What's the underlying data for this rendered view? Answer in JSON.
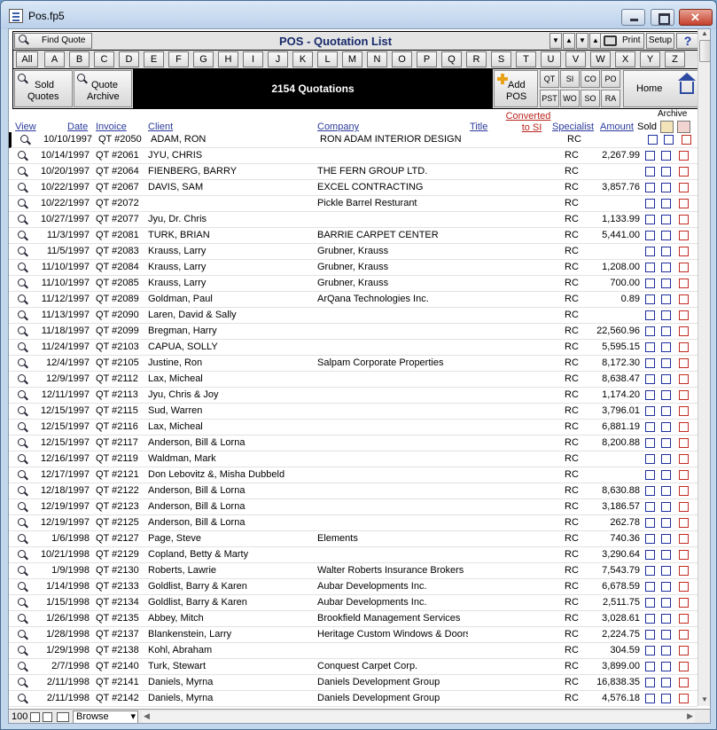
{
  "window": {
    "title": "Pos.fp5"
  },
  "toolbar": {
    "find_label": "Find Quote",
    "page_title": "POS - Quotation List",
    "print_label": "Print",
    "setup_label": "Setup",
    "help_label": "?"
  },
  "alphabet": [
    "All",
    "A",
    "B",
    "C",
    "D",
    "E",
    "F",
    "G",
    "H",
    "I",
    "J",
    "K",
    "L",
    "M",
    "N",
    "O",
    "P",
    "Q",
    "R",
    "S",
    "T",
    "U",
    "V",
    "W",
    "X",
    "Y",
    "Z"
  ],
  "buttons": {
    "sold_quotes": [
      "Sold",
      "Quotes"
    ],
    "quote_archive": [
      "Quote",
      "Archive"
    ],
    "count_text": "2154 Quotations",
    "add_pos": [
      "Add",
      "POS"
    ],
    "small": [
      "QT",
      "SI",
      "CO",
      "PO",
      "PST",
      "WO",
      "SO",
      "RA"
    ],
    "home": "Home"
  },
  "columns": {
    "view": "View",
    "date": "Date",
    "invoice": "Invoice",
    "client": "Client",
    "company": "Company",
    "title": "Title",
    "converted": [
      "Converted",
      "to SI"
    ],
    "specialist": "Specialist",
    "amount": "Amount",
    "sold": "Sold",
    "archive": "Archive"
  },
  "rows": [
    {
      "date": "10/10/1997",
      "invoice": "QT #2050",
      "client": "ADAM, RON",
      "company": "RON ADAM INTERIOR DESIGN",
      "specialist": "RC",
      "amount": ""
    },
    {
      "date": "10/14/1997",
      "invoice": "QT #2061",
      "client": "JYU, CHRIS",
      "company": "",
      "specialist": "RC",
      "amount": "2,267.99"
    },
    {
      "date": "10/20/1997",
      "invoice": "QT #2064",
      "client": "FIENBERG, BARRY",
      "company": "THE FERN GROUP LTD.",
      "specialist": "RC",
      "amount": ""
    },
    {
      "date": "10/22/1997",
      "invoice": "QT #2067",
      "client": "DAVIS, SAM",
      "company": "EXCEL CONTRACTING",
      "specialist": "RC",
      "amount": "3,857.76"
    },
    {
      "date": "10/22/1997",
      "invoice": "QT #2072",
      "client": "",
      "company": "Pickle Barrel   Resturant",
      "specialist": "RC",
      "amount": ""
    },
    {
      "date": "10/27/1997",
      "invoice": "QT #2077",
      "client": "Jyu, Dr. Chris",
      "company": "",
      "specialist": "RC",
      "amount": "1,133.99"
    },
    {
      "date": "11/3/1997",
      "invoice": "QT #2081",
      "client": "TURK, BRIAN",
      "company": "BARRIE CARPET CENTER",
      "specialist": "RC",
      "amount": "5,441.00"
    },
    {
      "date": "11/5/1997",
      "invoice": "QT #2083",
      "client": "Krauss, Larry",
      "company": "Grubner, Krauss",
      "specialist": "RC",
      "amount": ""
    },
    {
      "date": "11/10/1997",
      "invoice": "QT #2084",
      "client": "Krauss, Larry",
      "company": "Grubner, Krauss",
      "specialist": "RC",
      "amount": "1,208.00"
    },
    {
      "date": "11/10/1997",
      "invoice": "QT #2085",
      "client": "Krauss, Larry",
      "company": "Grubner, Krauss",
      "specialist": "RC",
      "amount": "700.00"
    },
    {
      "date": "11/12/1997",
      "invoice": "QT #2089",
      "client": "Goldman, Paul",
      "company": "ArQana Technologies Inc.",
      "specialist": "RC",
      "amount": "0.89"
    },
    {
      "date": "11/13/1997",
      "invoice": "QT #2090",
      "client": "Laren, David & Sally",
      "company": "",
      "specialist": "RC",
      "amount": ""
    },
    {
      "date": "11/18/1997",
      "invoice": "QT #2099",
      "client": "Bregman, Harry",
      "company": "",
      "specialist": "RC",
      "amount": "22,560.96"
    },
    {
      "date": "11/24/1997",
      "invoice": "QT #2103",
      "client": "CAPUA, SOLLY",
      "company": "",
      "specialist": "RC",
      "amount": "5,595.15"
    },
    {
      "date": "12/4/1997",
      "invoice": "QT #2105",
      "client": "Justine, Ron",
      "company": "Salpam Corporate Properties",
      "specialist": "RC",
      "amount": "8,172.30"
    },
    {
      "date": "12/9/1997",
      "invoice": "QT #2112",
      "client": "Lax, Micheal",
      "company": "",
      "specialist": "RC",
      "amount": "8,638.47"
    },
    {
      "date": "12/11/1997",
      "invoice": "QT #2113",
      "client": "Jyu, Chris & Joy",
      "company": "",
      "specialist": "RC",
      "amount": "1,174.20"
    },
    {
      "date": "12/15/1997",
      "invoice": "QT #2115",
      "client": "Sud, Warren",
      "company": "",
      "specialist": "RC",
      "amount": "3,796.01"
    },
    {
      "date": "12/15/1997",
      "invoice": "QT #2116",
      "client": "Lax, Micheal",
      "company": "",
      "specialist": "RC",
      "amount": "6,881.19"
    },
    {
      "date": "12/15/1997",
      "invoice": "QT #2117",
      "client": "Anderson, Bill & Lorna",
      "company": "",
      "specialist": "RC",
      "amount": "8,200.88"
    },
    {
      "date": "12/16/1997",
      "invoice": "QT #2119",
      "client": "Waldman, Mark",
      "company": "",
      "specialist": "RC",
      "amount": ""
    },
    {
      "date": "12/17/1997",
      "invoice": "QT #2121",
      "client": "Don Lebovitz &, Misha Dubbeld",
      "company": "",
      "specialist": "RC",
      "amount": ""
    },
    {
      "date": "12/18/1997",
      "invoice": "QT #2122",
      "client": "Anderson, Bill & Lorna",
      "company": "",
      "specialist": "RC",
      "amount": "8,630.88"
    },
    {
      "date": "12/19/1997",
      "invoice": "QT #2123",
      "client": "Anderson, Bill & Lorna",
      "company": "",
      "specialist": "RC",
      "amount": "3,186.57"
    },
    {
      "date": "12/19/1997",
      "invoice": "QT #2125",
      "client": "Anderson, Bill & Lorna",
      "company": "",
      "specialist": "RC",
      "amount": "262.78"
    },
    {
      "date": "1/6/1998",
      "invoice": "QT #2127",
      "client": "Page, Steve",
      "company": "Elements",
      "specialist": "RC",
      "amount": "740.36"
    },
    {
      "date": "10/21/1998",
      "invoice": "QT #2129",
      "client": "Copland, Betty & Marty",
      "company": "",
      "specialist": "RC",
      "amount": "3,290.64"
    },
    {
      "date": "1/9/1998",
      "invoice": "QT #2130",
      "client": "Roberts, Lawrie",
      "company": "Walter Roberts Insurance Brokers",
      "specialist": "RC",
      "amount": "7,543.79"
    },
    {
      "date": "1/14/1998",
      "invoice": "QT #2133",
      "client": "Goldlist, Barry & Karen",
      "company": "Aubar Developments Inc.",
      "specialist": "RC",
      "amount": "6,678.59"
    },
    {
      "date": "1/15/1998",
      "invoice": "QT #2134",
      "client": "Goldlist, Barry & Karen",
      "company": "Aubar Developments Inc.",
      "specialist": "RC",
      "amount": "2,511.75"
    },
    {
      "date": "1/26/1998",
      "invoice": "QT #2135",
      "client": "Abbey, Mitch",
      "company": "Brookfield Management Services",
      "specialist": "RC",
      "amount": "3,028.61"
    },
    {
      "date": "1/28/1998",
      "invoice": "QT #2137",
      "client": "Blankenstein, Larry",
      "company": "Heritage Custom Windows & Doors",
      "specialist": "RC",
      "amount": "2,224.75"
    },
    {
      "date": "1/29/1998",
      "invoice": "QT #2138",
      "client": "Kohl, Abraham",
      "company": "",
      "specialist": "RC",
      "amount": "304.59"
    },
    {
      "date": "2/7/1998",
      "invoice": "QT #2140",
      "client": "Turk, Stewart",
      "company": "Conquest Carpet Corp.",
      "specialist": "RC",
      "amount": "3,899.00"
    },
    {
      "date": "2/11/1998",
      "invoice": "QT #2141",
      "client": "Daniels, Myrna",
      "company": "Daniels Development Group",
      "specialist": "RC",
      "amount": "16,838.35"
    },
    {
      "date": "2/11/1998",
      "invoice": "QT #2142",
      "client": "Daniels, Myrna",
      "company": "Daniels Development Group",
      "specialist": "RC",
      "amount": "4,576.18"
    }
  ],
  "status": {
    "zoom": "100",
    "mode": "Browse"
  },
  "colors": {
    "link_blue": "#2b3b9b",
    "checkbox_blue": "#1e2fa0",
    "checkbox_red": "#c12b20",
    "count_panel_bg": "#000000"
  }
}
